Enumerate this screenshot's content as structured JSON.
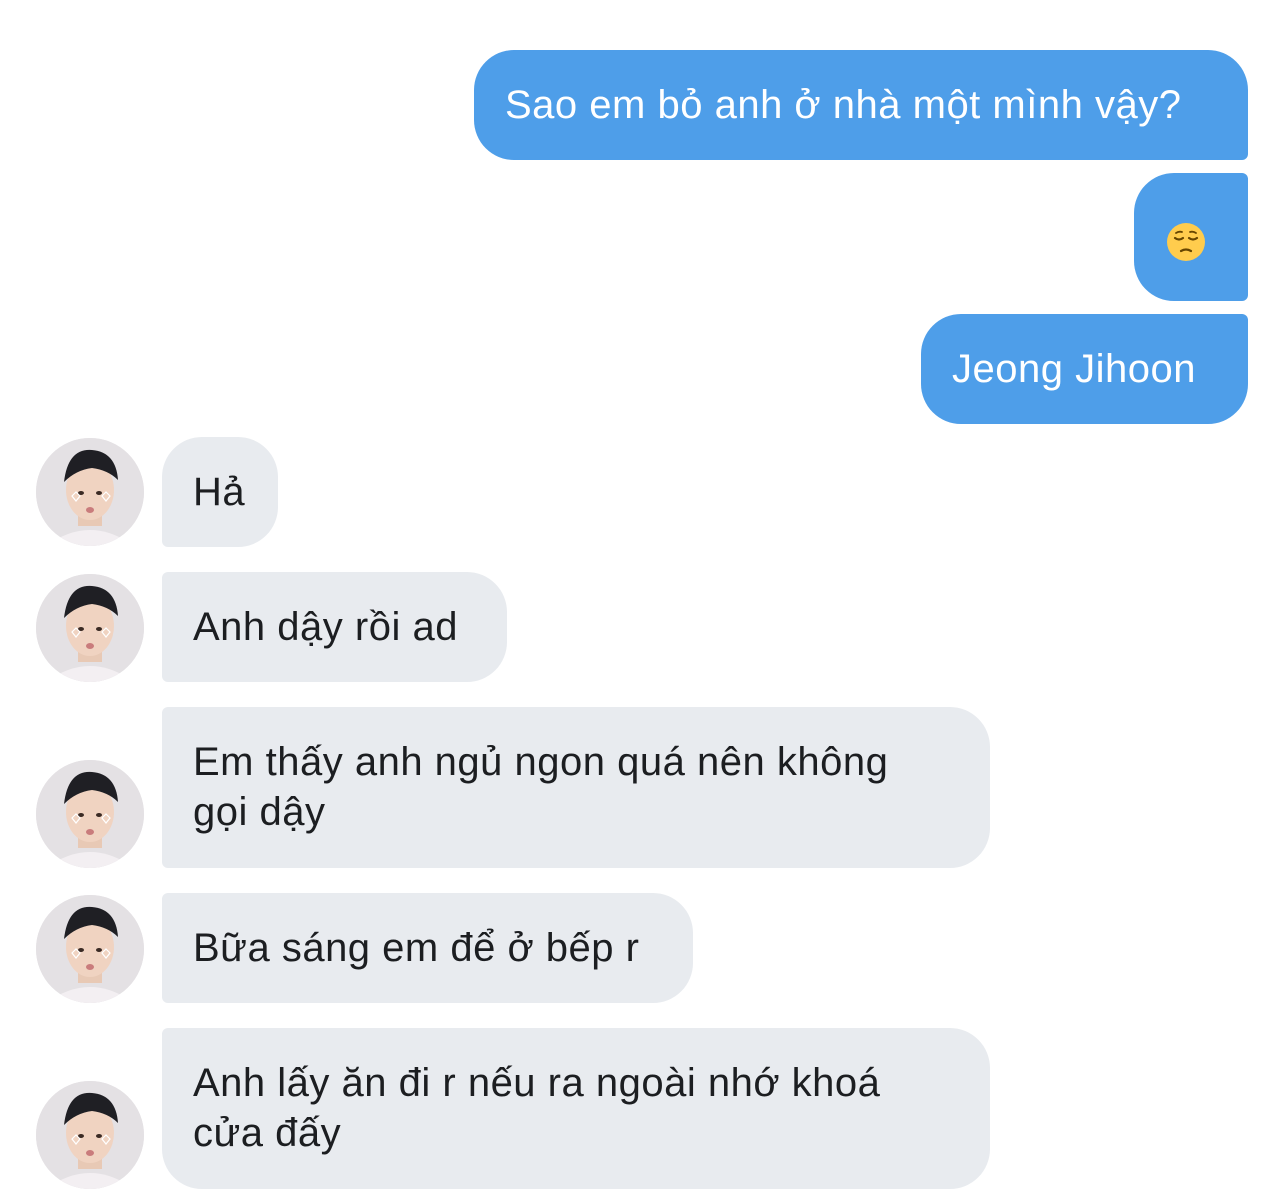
{
  "conversation": {
    "sent": [
      {
        "text": "Sao em bỏ anh ở nhà một mình vậy?"
      },
      {
        "emoji": "pensive-face"
      },
      {
        "text": "Jeong Jihoon"
      }
    ],
    "received": [
      {
        "text": "Hả"
      },
      {
        "text": "Anh dậy rồi ad"
      },
      {
        "line1": "Em thấy anh ngủ ngon quá nên không",
        "line2": "gọi dậy"
      },
      {
        "text": "Bữa sáng em để ở bếp r"
      },
      {
        "line1": "Anh lấy ăn đi r nếu ra ngoài nhớ khoá",
        "line2": "cửa đấy"
      }
    ]
  },
  "colors": {
    "sent_bubble": "#4e9ee9",
    "received_bubble": "#e8ebef",
    "sent_text": "#ffffff",
    "received_text": "#1c1e21"
  }
}
